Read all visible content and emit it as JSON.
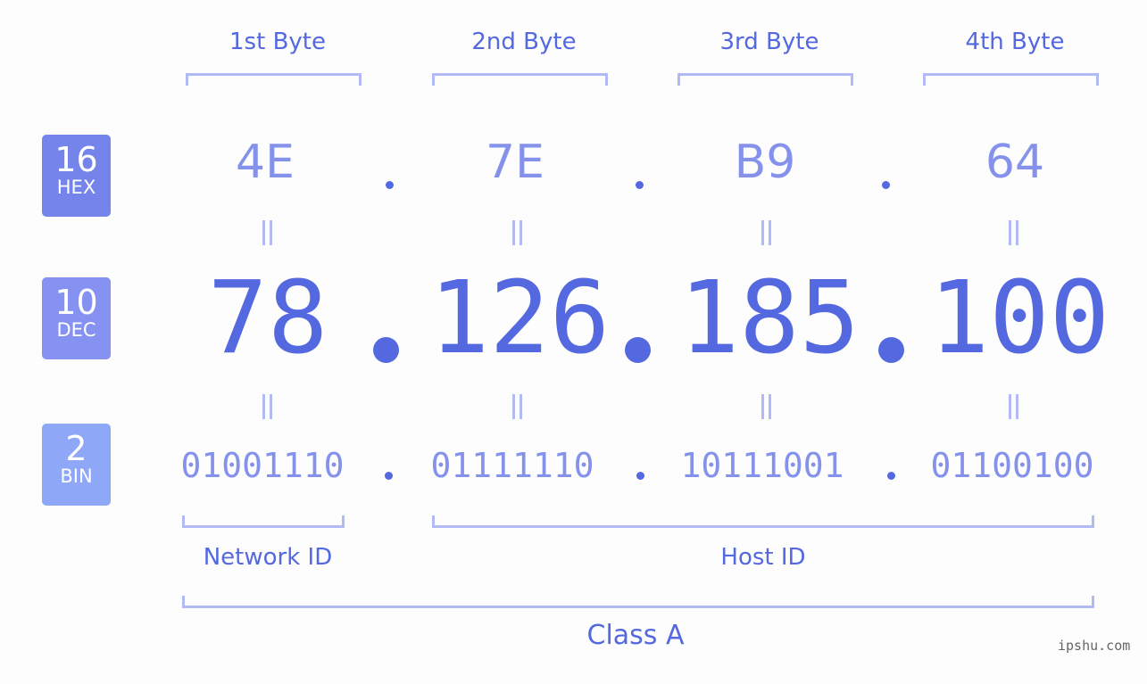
{
  "bases": [
    {
      "num": "16",
      "label": "HEX",
      "color": "#7584eb"
    },
    {
      "num": "10",
      "label": "DEC",
      "color": "#8592f2"
    },
    {
      "num": "2",
      "label": "BIN",
      "color": "#8fa7f7"
    }
  ],
  "bytes": [
    {
      "label": "1st Byte",
      "hex": "4E",
      "dec": "78",
      "bin": "01001110"
    },
    {
      "label": "2nd Byte",
      "hex": "7E",
      "dec": "126",
      "bin": "01111110"
    },
    {
      "label": "3rd Byte",
      "hex": "B9",
      "dec": "185",
      "bin": "10111001"
    },
    {
      "label": "4th Byte",
      "hex": "64",
      "dec": "100",
      "bin": "01100100"
    }
  ],
  "segments": {
    "network": "Network ID",
    "host": "Host ID",
    "class": "Class A"
  },
  "watermark": "ipshu.com",
  "colors": {
    "accent": "#5468e0",
    "light": "#8592eb",
    "bracket": "#b1baf5"
  }
}
